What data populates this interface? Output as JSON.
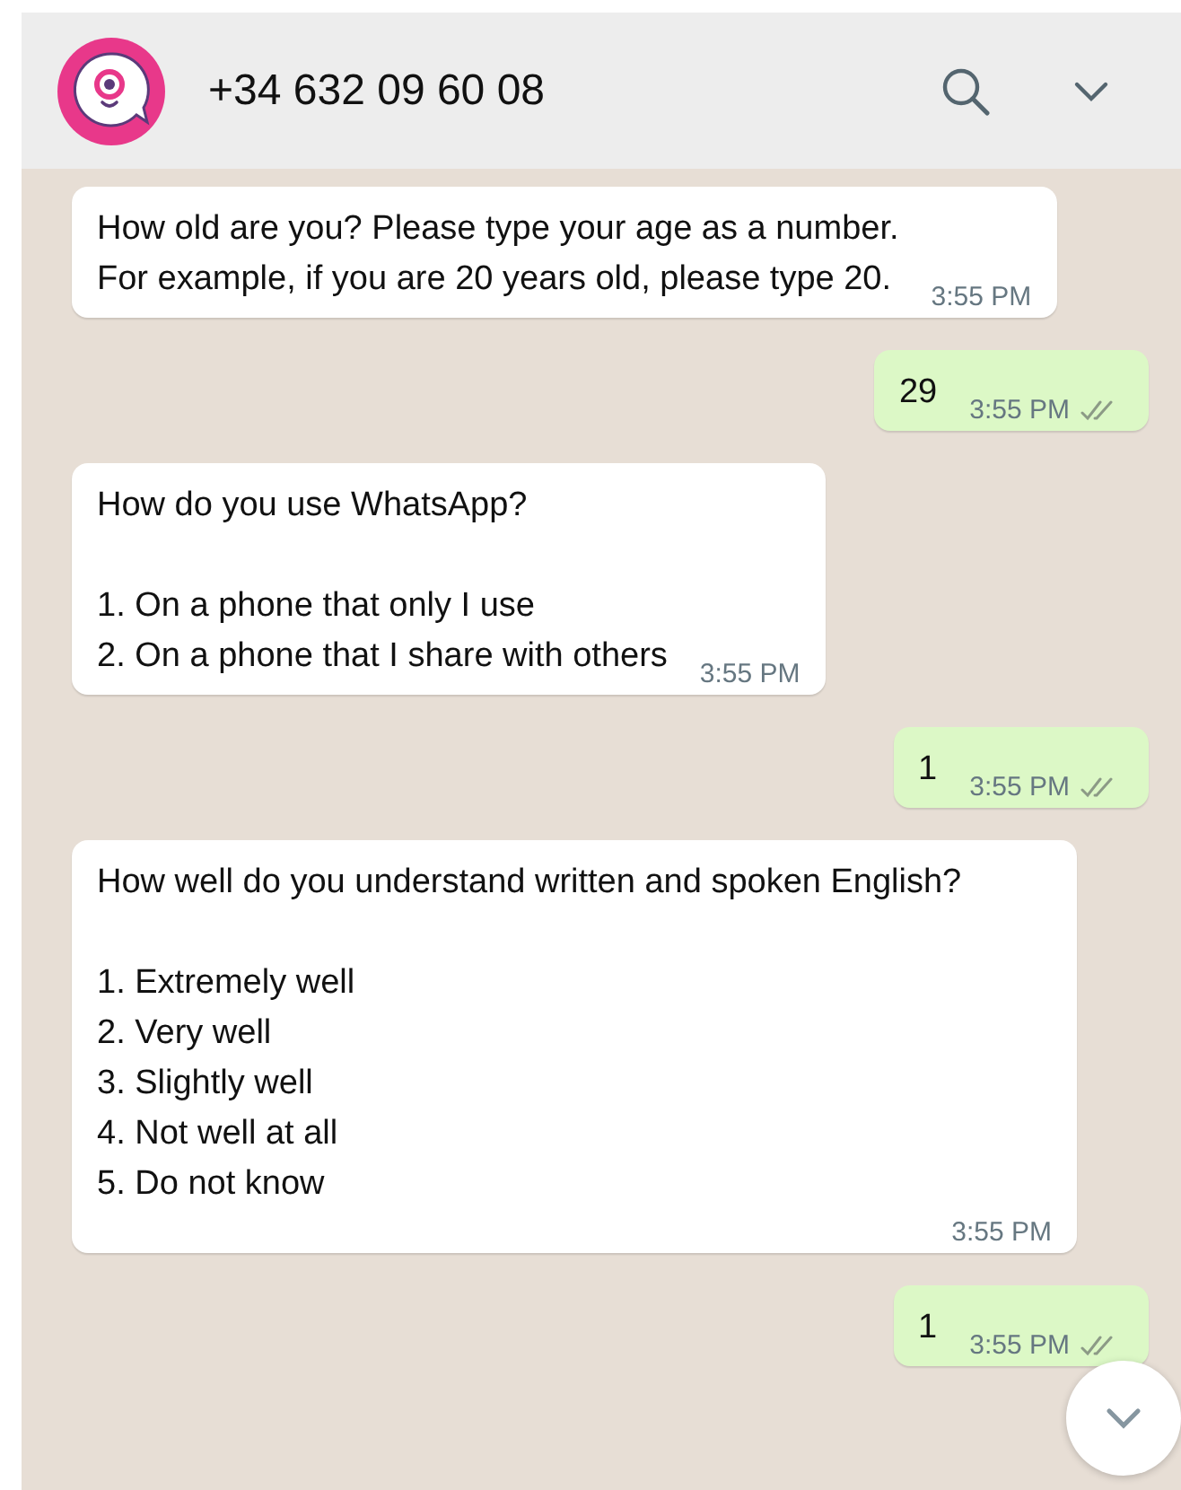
{
  "header": {
    "contact": "+34 632 09 60 08"
  },
  "messages": [
    {
      "outgoing": false,
      "text": "How old are you? Please type your age as a number.\nFor example, if you are 20 years old, please type 20.",
      "time": "3:55 PM"
    },
    {
      "outgoing": true,
      "text": "29",
      "time": "3:55 PM",
      "read": false
    },
    {
      "outgoing": false,
      "text": "How do you use WhatsApp?\n\n1. On a phone that only I use\n2. On a phone that I share with others",
      "time": "3:55 PM"
    },
    {
      "outgoing": true,
      "text": "1",
      "time": "3:55 PM",
      "read": false
    },
    {
      "outgoing": false,
      "text": "How well do you understand written and spoken English?\n\n1. Extremely well\n2. Very well\n3. Slightly well\n4. Not well at all\n5. Do not know",
      "time": "3:55 PM"
    },
    {
      "outgoing": true,
      "text": "1",
      "time": "3:55 PM",
      "read": false
    }
  ]
}
